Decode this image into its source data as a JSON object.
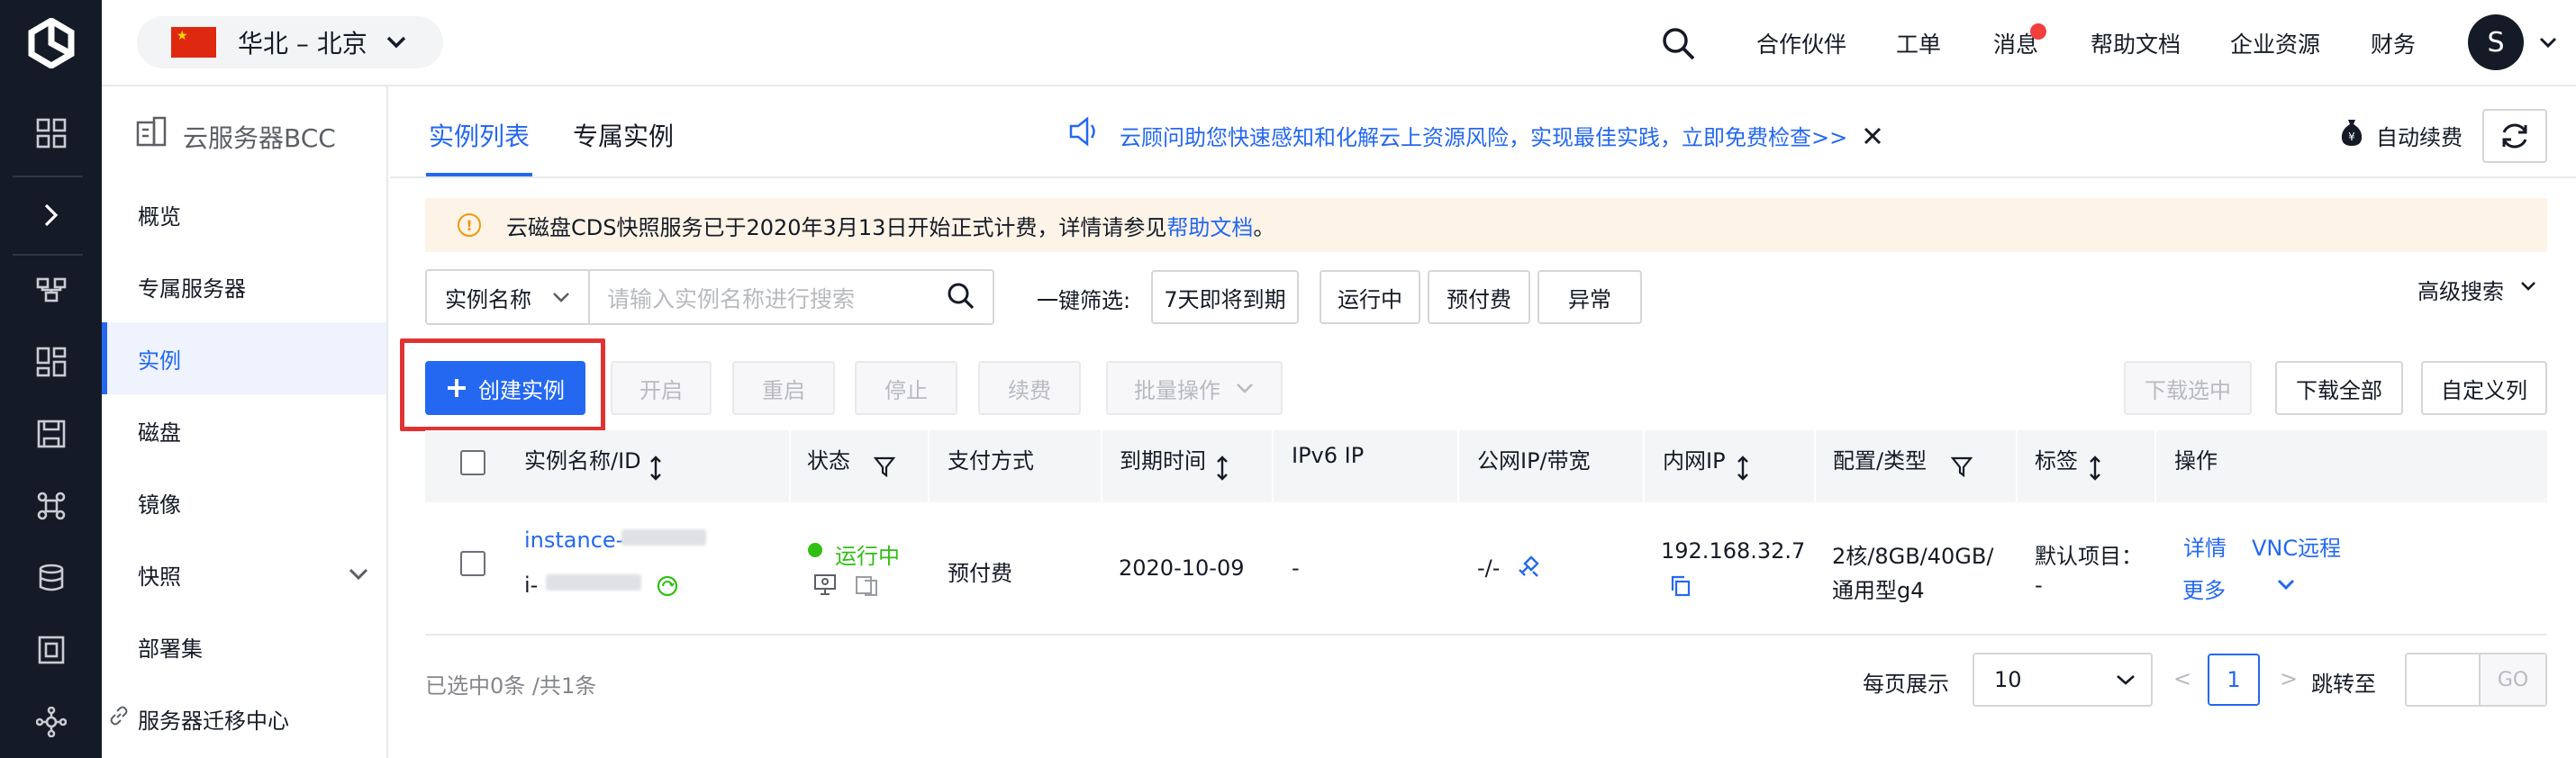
{
  "topbar": {
    "region_label": "华北 – 北京",
    "nav": [
      "合作伙伴",
      "工单",
      "消息",
      "帮助文档",
      "企业资源",
      "财务"
    ],
    "avatar_letter": "S"
  },
  "sidebar": {
    "title": "云服务器BCC",
    "items": [
      {
        "label": "概览"
      },
      {
        "label": "专属服务器"
      },
      {
        "label": "实例"
      },
      {
        "label": "磁盘"
      },
      {
        "label": "镜像"
      },
      {
        "label": "快照"
      },
      {
        "label": "部署集"
      },
      {
        "label": "服务器迁移中心"
      }
    ]
  },
  "tabs": [
    "实例列表",
    "专属实例"
  ],
  "notice": {
    "text": "云顾问助您快速感知和化解云上资源风险，实现最佳实践，立即免费检查>>"
  },
  "auto_renew_label": "自动续费",
  "alert": {
    "text": "云磁盘CDS快照服务已于2020年3月13日开始正式计费，详情请参见",
    "link": "帮助文档",
    "tail": "。"
  },
  "search": {
    "field": "实例名称",
    "placeholder": "请输入实例名称进行搜索"
  },
  "quick_filter": {
    "label": "一键筛选:",
    "options": [
      "7天即将到期",
      "运行中",
      "预付费",
      "异常"
    ]
  },
  "advanced_search": "高级搜索",
  "actions": {
    "create": "创建实例",
    "start": "开启",
    "restart": "重启",
    "stop": "停止",
    "renew": "续费",
    "batch": "批量操作",
    "download_selected": "下载选中",
    "download_all": "下载全部",
    "custom_columns": "自定义列"
  },
  "table": {
    "headers": [
      "实例名称/ID",
      "状态",
      "支付方式",
      "到期时间",
      "IPv6 IP",
      "公网IP/带宽",
      "内网IP",
      "配置/类型",
      "标签",
      "操作"
    ],
    "rows": [
      {
        "name": "instance-",
        "id": "i-",
        "status": "运行中",
        "payment": "预付费",
        "expire": "2020-10-09",
        "ipv6": "-",
        "public_ip": "-/-",
        "private_ip": "192.168.32.7",
        "config_line1": "2核/8GB/40GB/",
        "config_line2": "通用型g4",
        "tag_line1": "默认项目：",
        "tag_line2": "-",
        "op_detail": "详情",
        "op_vnc": "VNC远程",
        "op_more": "更多"
      }
    ]
  },
  "footer": {
    "selected_text": "已选中0条 /共1条",
    "per_page_label": "每页展示",
    "per_page_value": "10",
    "prev": "<",
    "current_page": "1",
    "next": ">",
    "jump_label": "跳转至",
    "go": "GO"
  },
  "colors": {
    "brand": "#2468f2",
    "rail": "#151b26",
    "running": "#30bf13",
    "highlight": "#e03333"
  }
}
